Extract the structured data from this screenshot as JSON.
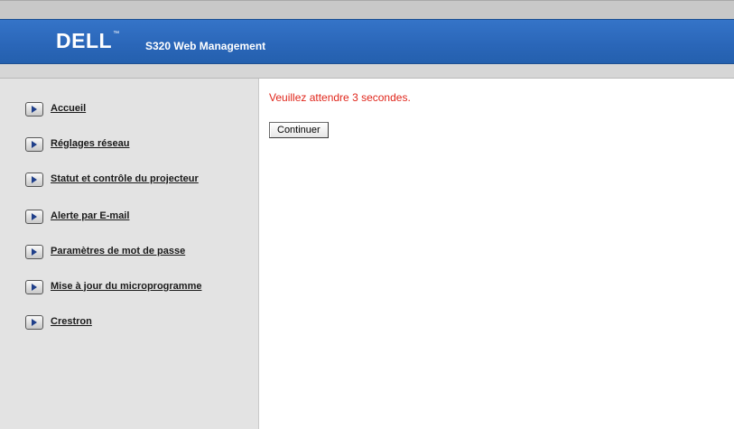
{
  "header": {
    "logo": "DELL",
    "logo_tm": "™",
    "title": "S320 Web Management"
  },
  "sidebar": {
    "items": [
      {
        "label": "Accueil",
        "icon": "arrow-right-icon"
      },
      {
        "label": "Réglages réseau",
        "icon": "arrow-right-icon"
      },
      {
        "label": "Statut et contrôle du projecteur",
        "icon": "arrow-right-icon"
      },
      {
        "label": "Alerte par E-mail",
        "icon": "arrow-right-icon"
      },
      {
        "label": "Paramètres de mot de passe",
        "icon": "arrow-right-icon"
      },
      {
        "label": "Mise à jour du microprogramme",
        "icon": "arrow-right-icon"
      },
      {
        "label": "Crestron",
        "icon": "arrow-right-icon"
      }
    ]
  },
  "main": {
    "message": "Veuillez attendre 3 secondes.",
    "continue_label": "Continuer"
  },
  "colors": {
    "header_blue": "#2a66b8",
    "message_red": "#e0261b",
    "sidebar_gray": "#e3e3e3"
  }
}
